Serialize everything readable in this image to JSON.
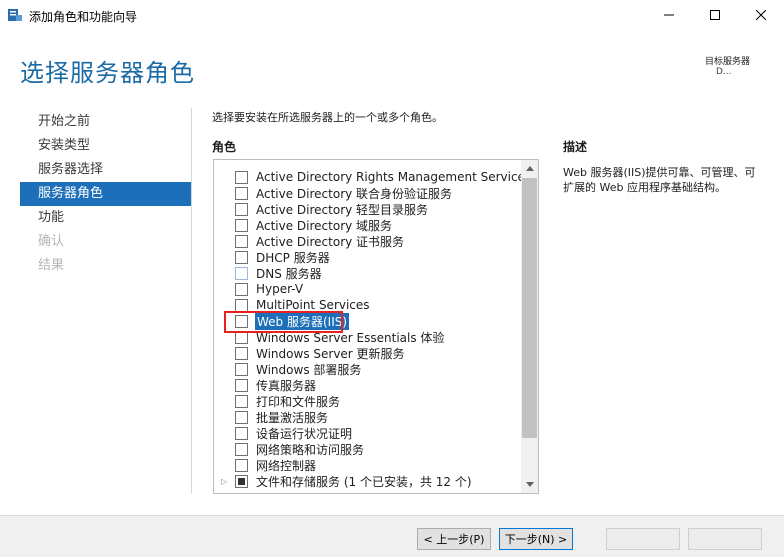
{
  "window": {
    "title": "添加角色和功能向导",
    "minimize_icon": "minimize-icon",
    "maximize_icon": "maximize-icon",
    "close_icon": "close-icon"
  },
  "header": {
    "page_title": "选择服务器角色",
    "target_label": "目标服务器",
    "target_value": "D..."
  },
  "nav": {
    "items": [
      {
        "label": "开始之前",
        "state": "normal"
      },
      {
        "label": "安装类型",
        "state": "normal"
      },
      {
        "label": "服务器选择",
        "state": "normal"
      },
      {
        "label": "服务器角色",
        "state": "active"
      },
      {
        "label": "功能",
        "state": "normal"
      },
      {
        "label": "确认",
        "state": "disabled"
      },
      {
        "label": "结果",
        "state": "disabled"
      }
    ]
  },
  "content": {
    "instruction": "选择要安装在所选服务器上的一个或多个角色。",
    "roles_heading": "角色",
    "description_heading": "描述",
    "description_text": "Web 服务器(IIS)提供可靠、可管理、可扩展的 Web 应用程序基础结构。"
  },
  "roles": [
    {
      "label": "Active Directory Rights Management Services",
      "checked": false
    },
    {
      "label": "Active Directory 联合身份验证服务",
      "checked": false
    },
    {
      "label": "Active Directory 轻型目录服务",
      "checked": false
    },
    {
      "label": "Active Directory 域服务",
      "checked": false
    },
    {
      "label": "Active Directory 证书服务",
      "checked": false
    },
    {
      "label": "DHCP 服务器",
      "checked": false
    },
    {
      "label": "DNS 服务器",
      "checked": false
    },
    {
      "label": "Hyper-V",
      "checked": false
    },
    {
      "label": "MultiPoint Services",
      "checked": false
    },
    {
      "label": "Web 服务器(IIS)",
      "checked": false,
      "selected": true
    },
    {
      "label": "Windows Server Essentials 体验",
      "checked": false
    },
    {
      "label": "Windows Server 更新服务",
      "checked": false
    },
    {
      "label": "Windows 部署服务",
      "checked": false
    },
    {
      "label": "传真服务器",
      "checked": false
    },
    {
      "label": "打印和文件服务",
      "checked": false
    },
    {
      "label": "批量激活服务",
      "checked": false
    },
    {
      "label": "设备运行状况证明",
      "checked": false
    },
    {
      "label": "网络策略和访问服务",
      "checked": false
    },
    {
      "label": "网络控制器",
      "checked": false
    },
    {
      "label": "文件和存储服务 (1 个已安装，共 12 个)",
      "checked": "partial",
      "expandable": true
    }
  ],
  "footer": {
    "prev_label": "< 上一步(P)",
    "next_label": "下一步(N) >",
    "install_label": "",
    "cancel_label": ""
  },
  "colors": {
    "accent": "#1e6fb9",
    "title": "#1b6ba5",
    "highlight_border": "#e52222"
  }
}
